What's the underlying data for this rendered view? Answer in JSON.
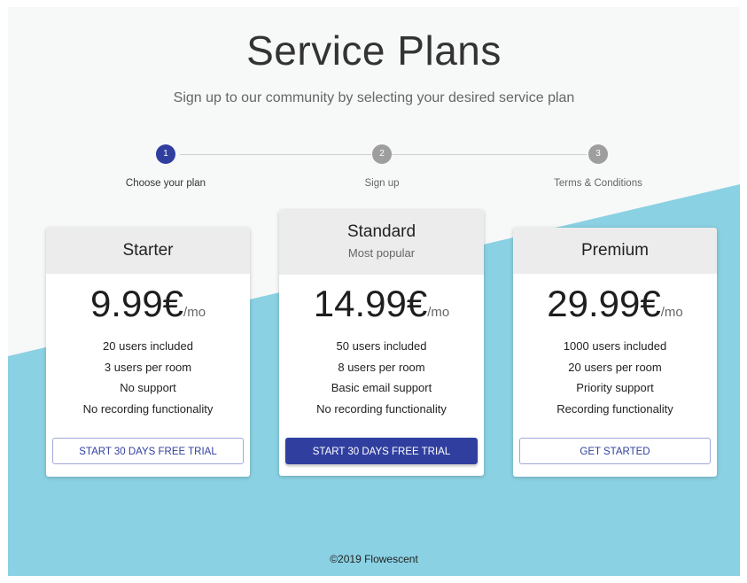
{
  "header": {
    "title": "Service Plans",
    "subtitle": "Sign up to our community by selecting your desired service plan"
  },
  "stepper": {
    "steps": [
      {
        "number": "1",
        "label": "Choose your plan",
        "active": true
      },
      {
        "number": "2",
        "label": "Sign up",
        "active": false
      },
      {
        "number": "3",
        "label": "Terms & Conditions",
        "active": false
      }
    ]
  },
  "plans": [
    {
      "name": "Starter",
      "tag": "",
      "price": "9.99€",
      "period": "/mo",
      "features": [
        "20 users included",
        "3 users per room",
        "No support",
        "No recording functionality"
      ],
      "button": "START 30 DAYS FREE TRIAL"
    },
    {
      "name": "Standard",
      "tag": "Most popular",
      "price": "14.99€",
      "period": "/mo",
      "features": [
        "50 users included",
        "8 users per room",
        "Basic email support",
        "No recording functionality"
      ],
      "button": "START 30 DAYS FREE TRIAL"
    },
    {
      "name": "Premium",
      "tag": "",
      "price": "29.99€",
      "period": "/mo",
      "features": [
        "1000 users included",
        "20 users per room",
        "Priority support",
        "Recording functionality"
      ],
      "button": "GET STARTED"
    }
  ],
  "footer": {
    "text": "©2019 Flowescent"
  },
  "colors": {
    "primary": "#303f9f",
    "step_inactive": "#9e9e9e",
    "background": "#f7f8f8",
    "accent_band": "#8ad1e3",
    "card_header": "#ececec"
  }
}
